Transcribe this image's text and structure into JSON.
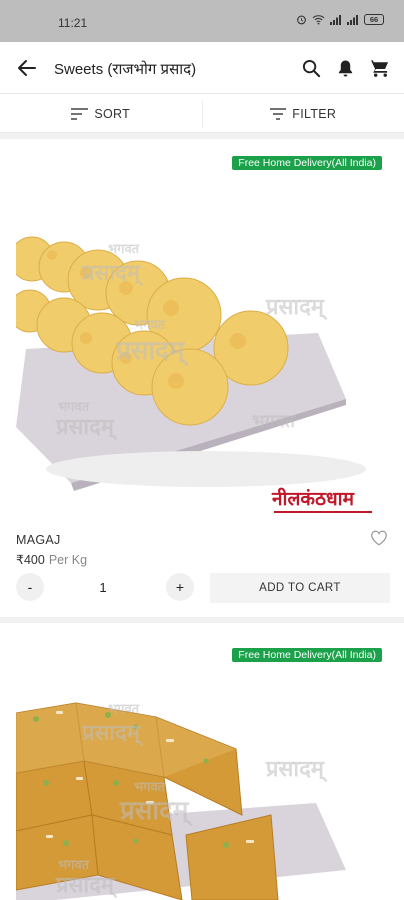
{
  "status_bar": {
    "time": "11:21",
    "battery": "66"
  },
  "app_bar": {
    "title": "Sweets (राजभोग प्रसाद)"
  },
  "toolbar": {
    "sort_label": "SORT",
    "filter_label": "FILTER"
  },
  "products": [
    {
      "name": "MAGAJ",
      "price": "₹400",
      "unit": "Per Kg",
      "badge": "Free Home Delivery(All India)",
      "quantity": "1",
      "minus_label": "-",
      "plus_label": "+",
      "add_to_cart_label": "ADD TO CART",
      "brand_logo": "नीलकंठधाम",
      "watermarks": [
        "भगवत",
        "प्रसादम्",
        "प्रसादम्",
        "भगवत",
        "प्रसादम्",
        "भगवत",
        "प्रसादम्",
        "भगवत"
      ]
    },
    {
      "badge": "Free Home Delivery(All India)",
      "watermarks": [
        "भगवत",
        "प्रसादम्",
        "प्रसादम्",
        "भगवत",
        "प्रसादम्",
        "भगवत",
        "प्रसादम्"
      ]
    }
  ],
  "colors": {
    "badge_green": "#1aa14a",
    "status_bar_gray": "#bdbdbd",
    "brand_red": "#c0182a"
  },
  "icons": [
    "back-arrow-icon",
    "search-icon",
    "bell-icon",
    "cart-icon",
    "sort-icon",
    "filter-icon",
    "heart-icon"
  ]
}
